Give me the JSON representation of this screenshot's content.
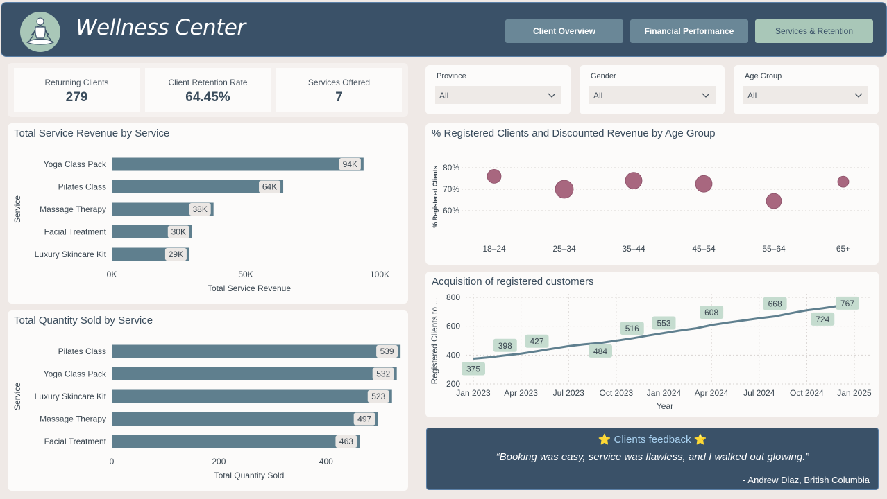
{
  "header": {
    "title": "Wellness Center",
    "logo_icon": "meditation-icon",
    "nav": [
      {
        "label": "Client Overview",
        "active": false
      },
      {
        "label": "Financial Performance",
        "active": false
      },
      {
        "label": "Services & Retention",
        "active": true
      }
    ]
  },
  "kpis": [
    {
      "label": "Returning Clients",
      "value": "279"
    },
    {
      "label": "Client Retention Rate",
      "value": "64.45%"
    },
    {
      "label": "Services Offered",
      "value": "7"
    }
  ],
  "filters": [
    {
      "label": "Province",
      "value": "All"
    },
    {
      "label": "Gender",
      "value": "All"
    },
    {
      "label": "Age Group",
      "value": "All"
    }
  ],
  "charts": {
    "revenue_title": "Total Service Revenue by Service",
    "quantity_title": "Total Quantity Sold by Service",
    "age_title": "% Registered Clients and Discounted Revenue by Age Group",
    "acq_title": "Acquisition of registered customers"
  },
  "feedback": {
    "title": "Clients feedback",
    "star": "⭐",
    "quote": "“Booking was easy, service was flawless, and I walked out glowing.”",
    "author": "- Andrew Diaz, British Columbia"
  },
  "colors": {
    "bar": "#5f7f8e",
    "bubble": "#a8677f",
    "line": "#5f7f8e",
    "label_bg": "#c5dccf",
    "header": "#3a5168"
  },
  "chart_data": [
    {
      "type": "bar",
      "title": "Total Service Revenue by Service",
      "xlabel": "Total Service Revenue",
      "ylabel": "Service",
      "categories": [
        "Yoga Class Pack",
        "Pilates Class",
        "Massage Therapy",
        "Facial Treatment",
        "Luxury Skincare Kit"
      ],
      "values": [
        94000,
        64000,
        38000,
        30000,
        29000
      ],
      "value_labels": [
        "94K",
        "64K",
        "38K",
        "30K",
        "29K"
      ],
      "xlim": [
        0,
        100000
      ],
      "xticks": [
        0,
        50000,
        100000
      ],
      "xtick_labels": [
        "0K",
        "50K",
        "100K"
      ]
    },
    {
      "type": "bar",
      "title": "Total Quantity Sold by Service",
      "xlabel": "Total Quantity Sold",
      "ylabel": "Service",
      "categories": [
        "Pilates Class",
        "Yoga Class Pack",
        "Luxury Skincare Kit",
        "Massage Therapy",
        "Facial Treatment"
      ],
      "values": [
        539,
        532,
        523,
        497,
        463
      ],
      "value_labels": [
        "539",
        "532",
        "523",
        "497",
        "463"
      ],
      "xlim": [
        0,
        500
      ],
      "xticks": [
        0,
        200,
        400
      ],
      "xtick_labels": [
        "0",
        "200",
        "400"
      ]
    },
    {
      "type": "scatter",
      "title": "% Registered Clients and Discounted Revenue by Age Group",
      "ylabel": "% Registered Clients",
      "categories": [
        "18–24",
        "25–34",
        "35–44",
        "45–54",
        "55–64",
        "65+"
      ],
      "values": [
        76,
        70,
        74,
        72.5,
        64.5,
        73.5
      ],
      "sizes": [
        10,
        13,
        12,
        12,
        11,
        8
      ],
      "ylim": [
        60,
        80
      ],
      "yticks": [
        60,
        70,
        80
      ],
      "ytick_labels": [
        "60%",
        "70%",
        "80%"
      ]
    },
    {
      "type": "line",
      "title": "Acquisition of registered customers",
      "xlabel": "Year",
      "ylabel": "Registered Clients to ...",
      "x": [
        "2023-01",
        "2023-02",
        "2023-03",
        "2023-04",
        "2023-05",
        "2023-06",
        "2023-07",
        "2023-08",
        "2023-09",
        "2023-10",
        "2023-11",
        "2023-12",
        "2024-01",
        "2024-02",
        "2024-03",
        "2024-04",
        "2024-05",
        "2024-06",
        "2024-07",
        "2024-08",
        "2024-09",
        "2024-10",
        "2024-11",
        "2024-12",
        "2025-01"
      ],
      "values": [
        375,
        385,
        398,
        410,
        427,
        445,
        462,
        475,
        484,
        500,
        516,
        535,
        553,
        570,
        585,
        608,
        625,
        640,
        655,
        668,
        690,
        710,
        724,
        740,
        767
      ],
      "labeled_points": [
        {
          "x": "2023-01",
          "label": "375"
        },
        {
          "x": "2023-03",
          "label": "398"
        },
        {
          "x": "2023-05",
          "label": "427"
        },
        {
          "x": "2023-09",
          "label": "484"
        },
        {
          "x": "2023-11",
          "label": "516"
        },
        {
          "x": "2024-01",
          "label": "553"
        },
        {
          "x": "2024-04",
          "label": "608"
        },
        {
          "x": "2024-08",
          "label": "668"
        },
        {
          "x": "2024-11",
          "label": "724"
        },
        {
          "x": "2025-01",
          "label": "767"
        }
      ],
      "ylim": [
        200,
        800
      ],
      "yticks": [
        200,
        400,
        600,
        800
      ],
      "xtick_labels": [
        "Jan 2023",
        "Apr 2023",
        "Jul 2023",
        "Oct 2023",
        "Jan 2024",
        "Apr 2024",
        "Jul 2024",
        "Oct 2024",
        "Jan 2025"
      ]
    }
  ]
}
